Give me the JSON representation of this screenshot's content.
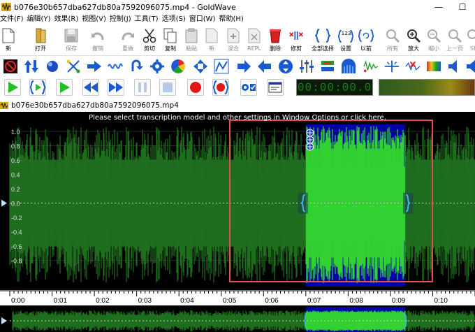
{
  "window": {
    "title": "b076e30b657dba627db80a7592096075.mp4 - GoldWave",
    "minimize_glyph": "—",
    "maximize_glyph": "☐"
  },
  "menu": {
    "items": [
      "文件(F)",
      "编辑(Y)",
      "效果(R)",
      "视图(V)",
      "控制(J)",
      "工具(T)",
      "选项(S)",
      "窗口(W)",
      "帮助(H)"
    ]
  },
  "toolbar": {
    "buttons": [
      {
        "label": "新",
        "icon": "new-file-icon",
        "enabled": true
      },
      {
        "label": "打开",
        "icon": "open-folder-icon",
        "enabled": true
      },
      {
        "label": "保存",
        "icon": "save-icon",
        "enabled": false
      },
      {
        "label": "撤销",
        "icon": "undo-icon",
        "enabled": false
      },
      {
        "label": "重做",
        "icon": "redo-icon",
        "enabled": false
      },
      {
        "label": "剪切",
        "icon": "cut-icon",
        "enabled": true
      },
      {
        "label": "复制",
        "icon": "copy-icon",
        "enabled": true
      },
      {
        "label": "粘贴",
        "icon": "paste-icon",
        "enabled": false
      },
      {
        "label": "新",
        "icon": "paste-new-icon",
        "enabled": false
      },
      {
        "label": "混合",
        "icon": "mix-icon",
        "enabled": false
      },
      {
        "label": "REPL",
        "icon": "replace-icon",
        "enabled": false
      },
      {
        "label": "删除",
        "icon": "delete-icon",
        "enabled": true
      },
      {
        "label": "修剪",
        "icon": "trim-icon",
        "enabled": true
      },
      {
        "label": "全部选择",
        "icon": "select-all-icon",
        "enabled": true
      },
      {
        "label": "设置",
        "icon": "set-selection-icon",
        "enabled": true
      },
      {
        "label": "以前",
        "icon": "previous-selection-icon",
        "enabled": true
      },
      {
        "label": "所有",
        "icon": "zoom-all-icon",
        "enabled": false
      },
      {
        "label": "放大",
        "icon": "zoom-in-icon",
        "enabled": true
      },
      {
        "label": "缩小",
        "icon": "zoom-out-icon",
        "enabled": false
      },
      {
        "label": "上一页",
        "icon": "zoom-previous-icon",
        "enabled": false
      },
      {
        "label": "SE",
        "icon": "zoom-selection-icon",
        "enabled": false
      }
    ]
  },
  "counter": {
    "time": "00:00:00.0"
  },
  "document": {
    "title": "b076e30b657dba627db80a7592096075.mp4",
    "notice": "Please select transcription model and other settings in Window Options or click here."
  },
  "waveform": {
    "y_labels": [
      "1.0",
      "0.8",
      "0.6",
      "0.4",
      "0.2",
      "0.0",
      "-0.2",
      "-0.4",
      "-0.6",
      "-0.8"
    ],
    "time_labels": [
      "0:00",
      "0:01",
      "0:02",
      "0:03",
      "0:04",
      "0:05",
      "0:06",
      "0:07",
      "0:08",
      "0:09",
      "0:10",
      "0:11"
    ],
    "selection": {
      "start_seconds": 7.0,
      "end_seconds": 9.35
    },
    "visible_seconds": 11.0,
    "colors": {
      "background": "#000000",
      "wave_unselected": "#1f6e1f",
      "wave_selected": "#33d133",
      "selection_background": "#0000a8",
      "highlight_box": "#e05050",
      "marker": "#3fb8e8"
    }
  }
}
